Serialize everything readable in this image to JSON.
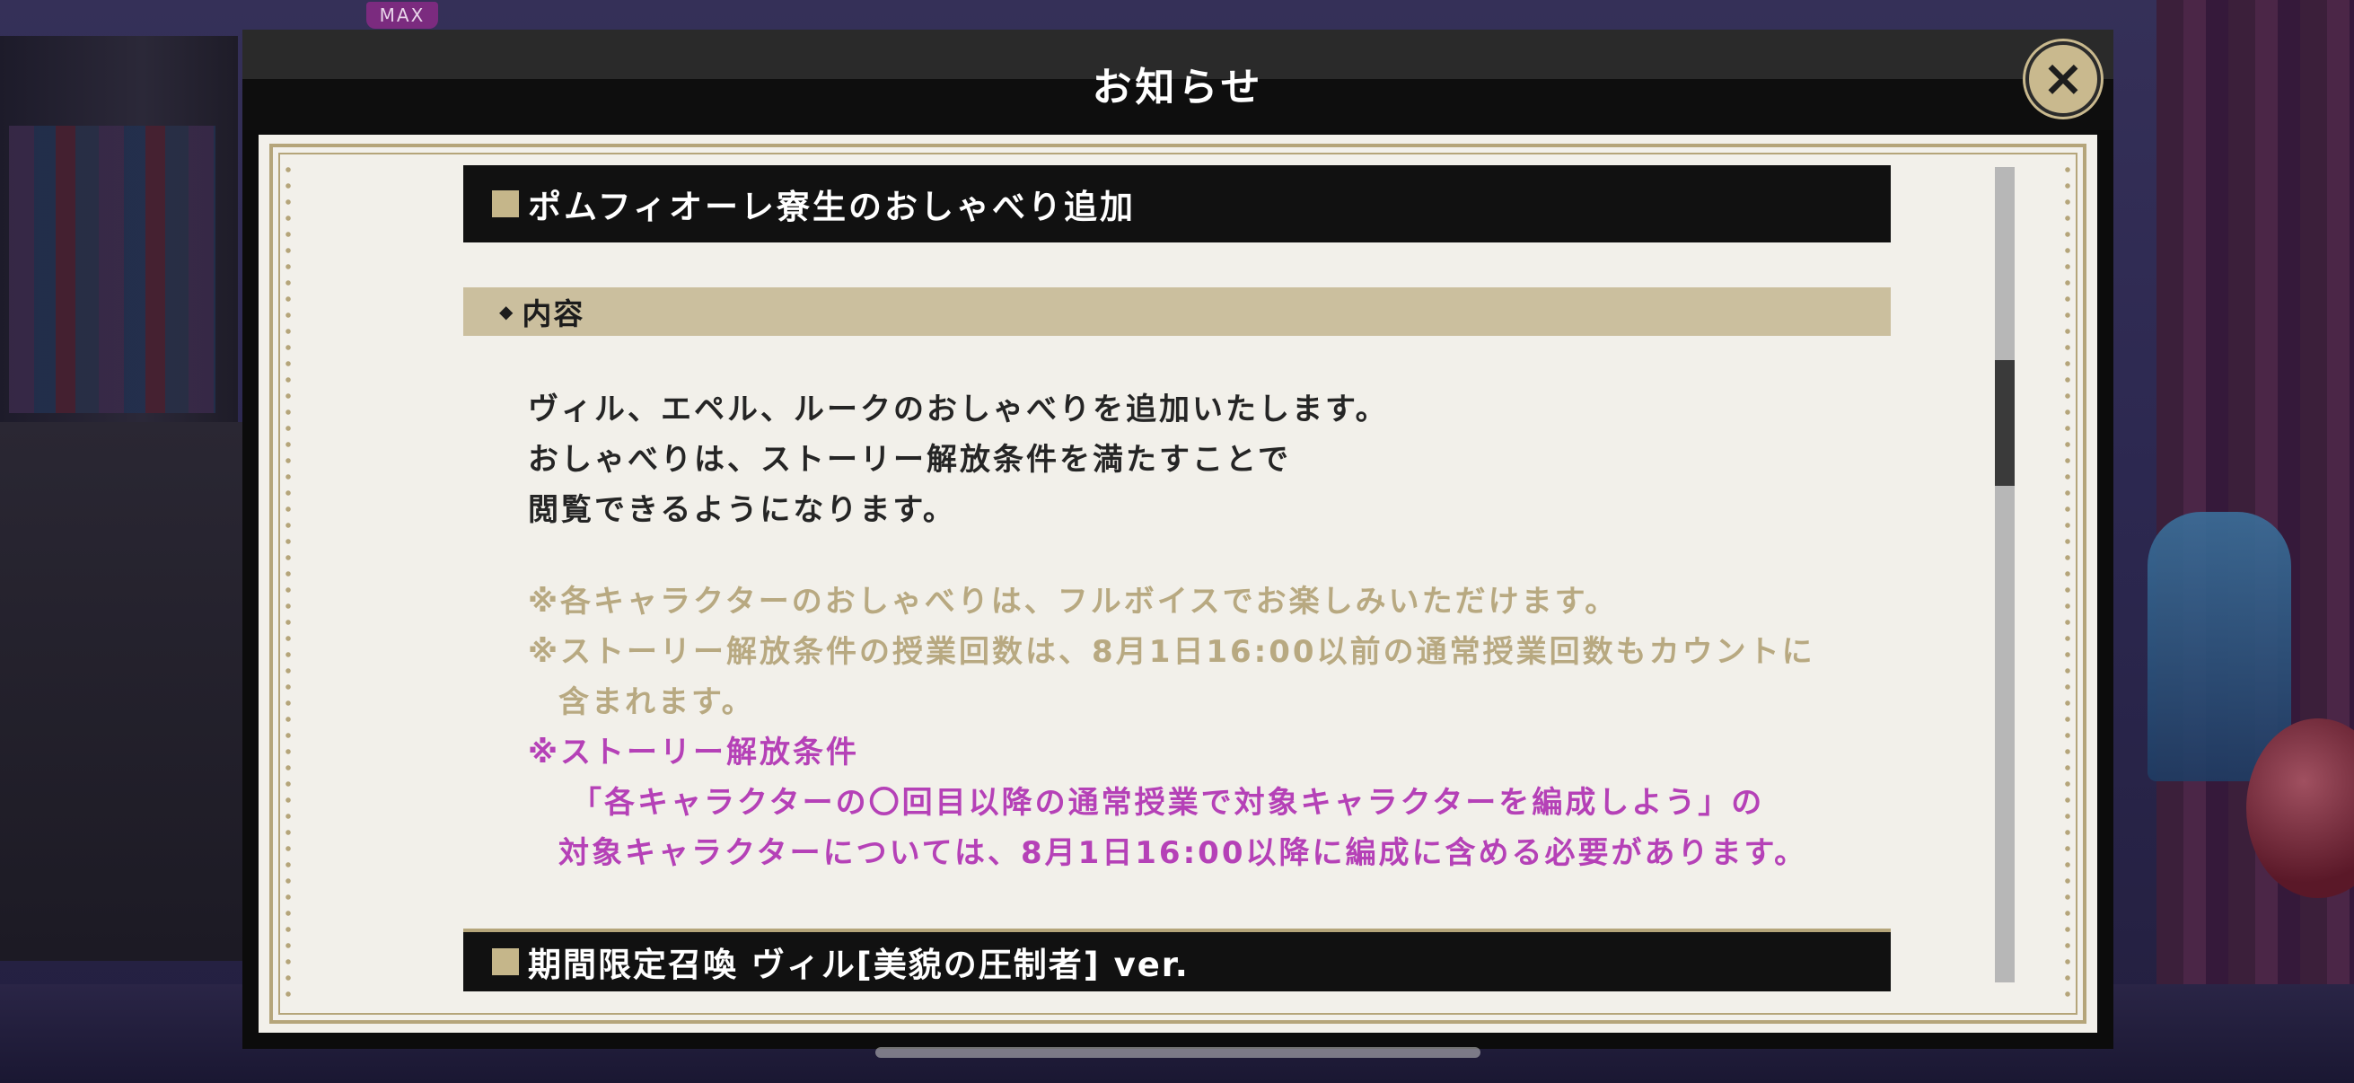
{
  "level_badge": "MAX",
  "modal": {
    "title": "お知らせ",
    "close_label": "×"
  },
  "notice": {
    "section_title": "ポムフィオーレ寮生のおしゃべり追加",
    "subheading": "内容",
    "body_lines": [
      "ヴィル、エペル、ルークのおしゃべりを追加いたします。",
      "おしゃべりは、ストーリー解放条件を満たすことで",
      "閲覧できるようになります。"
    ],
    "note_lines": [
      "※各キャラクターのおしゃべりは、フルボイスでお楽しみいただけます。",
      "※ストーリー解放条件の授業回数は、8月1日16:00以前の通常授業回数もカウントに",
      "含まれます。"
    ],
    "highlight_lines": [
      "※ストーリー解放条件",
      "「各キャラクターの〇回目以降の通常授業で対象キャラクターを編成しよう」の",
      "対象キャラクターについては、8月1日16:00以降に編成に含める必要があります。"
    ],
    "next_section_title": "期間限定召喚 ヴィル[美貌の圧制者] ver."
  },
  "colors": {
    "accent_gold": "#c5b68a",
    "note_text": "#b8a981",
    "highlight_text": "#b541b7",
    "heading_bg": "#111111"
  },
  "scroll": {
    "position_fraction": 0.28
  }
}
